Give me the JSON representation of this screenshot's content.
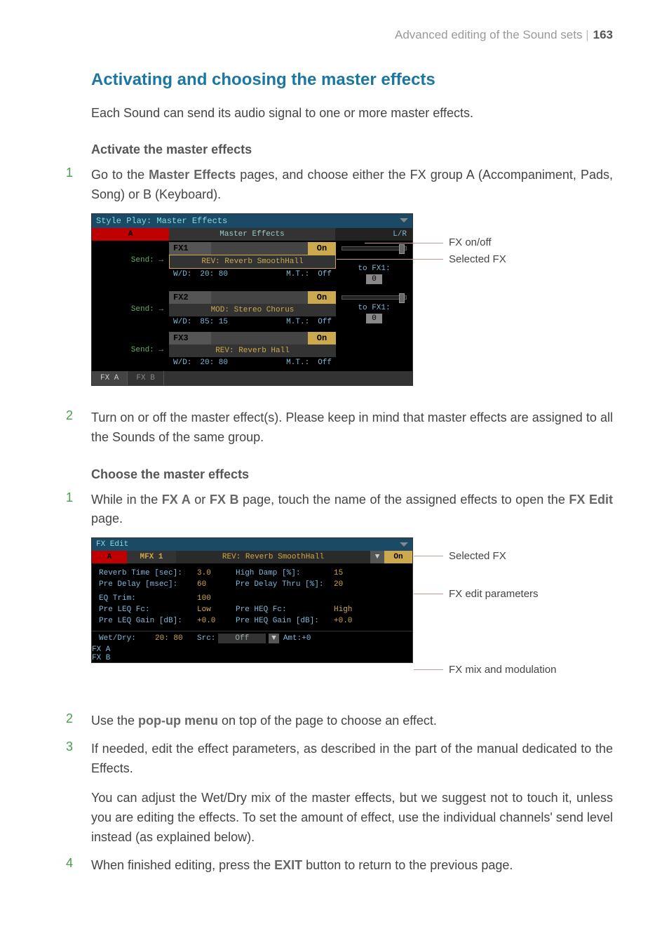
{
  "header": {
    "title_left": "Advanced editing of the Sound sets",
    "page": "163"
  },
  "headings": {
    "main": "Activating and choosing the master effects",
    "intro": "Each Sound can send its audio signal to one or more master effects.",
    "sub1": "Activate the master effects",
    "sub2": "Choose the master effects"
  },
  "steps": {
    "s1": {
      "pre": "Go to the ",
      "b1": "Master Effects",
      "post": " pages, and choose either the FX group A (Accompaniment, Pads, Song) or B (Keyboard)."
    },
    "s2": "Turn on or off the master effect(s). Please keep in mind that master effects are assigned to all the Sounds of the same group.",
    "s3": {
      "t1": "While in the ",
      "b1": "FX A",
      "t2": " or ",
      "b2": "FX B",
      "t3": " page, touch the name of the assigned effects to open the ",
      "b3": "FX Edit",
      "t4": " page."
    },
    "s4": {
      "t1": "Use the ",
      "b1": "pop-up menu",
      "t2": " on top of the page to choose an effect."
    },
    "s5": "If needed, edit the effect parameters, as described in the part of the manual dedicated to the Effects.",
    "s5b": "You can adjust the Wet/Dry mix of the master effects, but we suggest not to touch it, unless you are editing the effects. To set the amount of effect, use the individual channels' send level instead (as explained below).",
    "s6": {
      "t1": "When finished editing, press the ",
      "b1": "EXIT",
      "t2": " button to return to the previous page."
    }
  },
  "callouts1": {
    "a": "FX on/off",
    "b": "Selected FX"
  },
  "callouts2": {
    "a": "Selected FX",
    "b": "FX edit parameters",
    "c": "FX mix and modulation"
  },
  "shot1": {
    "title": "Style Play: Master Effects",
    "tab_a": "A",
    "master_effects": "Master Effects",
    "lr": "L/R",
    "send": "Send:",
    "fx": [
      {
        "label": "FX1",
        "on": "On",
        "name": "REV: Reverb SmoothHall",
        "wd": "W/D:",
        "wdval": "20: 80",
        "mt": "M.T.:",
        "mtval": "Off",
        "selected": true
      },
      {
        "label": "FX2",
        "on": "On",
        "name": "MOD: Stereo Chorus",
        "wd": "W/D:",
        "wdval": "85: 15",
        "mt": "M.T.:",
        "mtval": "Off",
        "selected": false
      },
      {
        "label": "FX3",
        "on": "On",
        "name": "REV: Reverb Hall",
        "wd": "W/D:",
        "wdval": "20: 80",
        "mt": "M.T.:",
        "mtval": "Off",
        "selected": false
      }
    ],
    "tofx": "to FX1:",
    "tofxval": "0",
    "tab_fxa": "FX A",
    "tab_fxb": "FX B"
  },
  "shot2": {
    "title": "FX Edit",
    "tab_a": "A",
    "mfx": "MFX 1",
    "fxname": "REV: Reverb SmoothHall",
    "on": "On",
    "params": [
      {
        "l1": "Reverb Time [sec]:",
        "v1": "3.0",
        "l2": "High Damp [%]:",
        "v2": "15"
      },
      {
        "l1": "Pre Delay [msec]:",
        "v1": "60",
        "l2": "Pre Delay Thru [%]:",
        "v2": "20"
      },
      {
        "l1": "",
        "v1": "",
        "l2": "",
        "v2": ""
      },
      {
        "l1": "EQ Trim:",
        "v1": "100",
        "l2": "",
        "v2": ""
      },
      {
        "l1": "Pre LEQ Fc:",
        "v1": "Low",
        "l2": "Pre HEQ Fc:",
        "v2": "High"
      },
      {
        "l1": "Pre LEQ Gain [dB]:",
        "v1": "+0.0",
        "l2": "Pre HEQ Gain [dB]:",
        "v2": "+0.0"
      }
    ],
    "wd": {
      "lab": "Wet/Dry:",
      "val": "20: 80",
      "src": "Src:",
      "srcval": "Off",
      "amt": "Amt:+0"
    },
    "tab_fxa": "FX A",
    "tab_fxb": "FX B"
  }
}
